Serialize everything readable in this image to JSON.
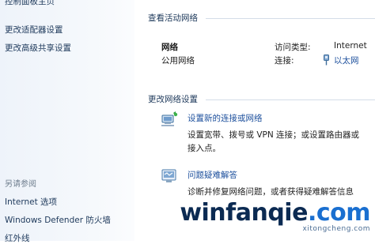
{
  "sidebar": {
    "home_link": "控制面板主页",
    "adapter_link": "更改适配器设置",
    "sharing_link": "更改高级共享设置",
    "see_also_label": "另请参阅",
    "see_also_items": [
      "Internet 选项",
      "Windows Defender 防火墙",
      "红外线"
    ]
  },
  "active_networks": {
    "header": "查看活动网络",
    "network_name": "网络",
    "network_type": "公用网络",
    "access_type_label": "访问类型:",
    "access_type_value": "Internet",
    "connection_label": "连接:",
    "connection_value": "以太网"
  },
  "change_settings": {
    "header": "更改网络设置",
    "items": [
      {
        "title": "设置新的连接或网络",
        "desc_line1": "设置宽带、拨号或 VPN 连接；或设置路由器或",
        "desc_line2": "接入点。",
        "icon": "new-connection-icon"
      },
      {
        "title": "问题疑难解答",
        "desc_line1": "诊断并修复网络问题，或者获得疑难解答信息",
        "icon": "troubleshoot-icon"
      }
    ]
  },
  "watermark": {
    "main_a": "winfanqie",
    "main_b": ".com",
    "sub": "xitongcheng.com"
  },
  "colors": {
    "link": "#1e395b",
    "action_link": "#1c4f9c",
    "sidebar_bg": "#eef3fa",
    "watermark": "#0b2a52"
  }
}
